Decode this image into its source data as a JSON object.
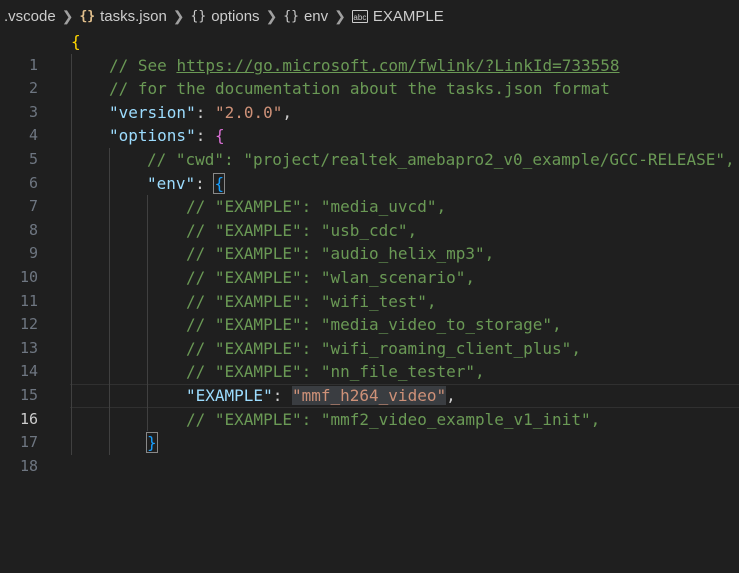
{
  "breadcrumb": {
    "folder": ".vscode",
    "file": "tasks.json",
    "node1": "options",
    "node2": "env",
    "node3": "EXAMPLE",
    "file_icon": "braces-icon",
    "prop_icon": "string-abc-icon"
  },
  "editor": {
    "current_line": 16,
    "lines": [
      {
        "n": "1",
        "code": "{"
      },
      {
        "n": "2",
        "comment_pre": "// See ",
        "link": "https://go.microsoft.com/fwlink/?LinkId=733558"
      },
      {
        "n": "3",
        "comment": "// for the documentation about the tasks.json format"
      },
      {
        "n": "4",
        "key": "\"version\"",
        "value": "\"2.0.0\""
      },
      {
        "n": "5",
        "key": "\"options\"",
        "brace": "{"
      },
      {
        "n": "6",
        "comment": "// \"cwd\": \"project/realtek_amebapro2_v0_example/GCC-RELEASE\","
      },
      {
        "n": "7",
        "key": "\"env\"",
        "brace": "{"
      },
      {
        "n": "8",
        "comment": "// \"EXAMPLE\": \"media_uvcd\","
      },
      {
        "n": "9",
        "comment": "// \"EXAMPLE\": \"usb_cdc\","
      },
      {
        "n": "10",
        "comment": "// \"EXAMPLE\": \"audio_helix_mp3\","
      },
      {
        "n": "11",
        "comment": "// \"EXAMPLE\": \"wlan_scenario\","
      },
      {
        "n": "12",
        "comment": "// \"EXAMPLE\": \"wifi_test\","
      },
      {
        "n": "13",
        "comment": "// \"EXAMPLE\": \"media_video_to_storage\","
      },
      {
        "n": "14",
        "comment": "// \"EXAMPLE\": \"wifi_roaming_client_plus\","
      },
      {
        "n": "15",
        "comment": "// \"EXAMPLE\": \"nn_file_tester\","
      },
      {
        "n": "16",
        "key": "\"EXAMPLE\"",
        "value": "\"mmf_h264_video\""
      },
      {
        "n": "17",
        "comment": "// \"EXAMPLE\": \"mmf2_video_example_v1_init\","
      },
      {
        "n": "18",
        "brace": "}"
      }
    ]
  }
}
